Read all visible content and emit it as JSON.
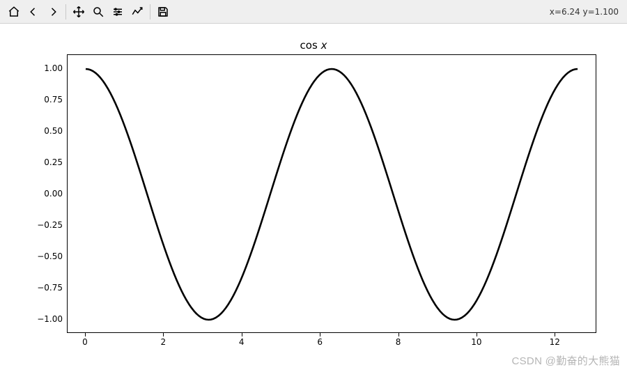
{
  "toolbar": {
    "icons": [
      {
        "name": "home-icon"
      },
      {
        "name": "back-icon"
      },
      {
        "name": "forward-icon"
      },
      {
        "_sep": true
      },
      {
        "name": "pan-icon"
      },
      {
        "name": "zoom-icon"
      },
      {
        "name": "subplots-icon"
      },
      {
        "name": "customize-icon"
      },
      {
        "_sep": true
      },
      {
        "name": "save-icon"
      }
    ],
    "coord_readout": "x=6.24 y=1.100"
  },
  "chart_data": {
    "type": "line",
    "title": "cos x",
    "xlabel": "",
    "ylabel": "",
    "xlim": [
      0,
      12.6
    ],
    "ylim": [
      -1.0,
      1.0
    ],
    "xticks": [
      0,
      2,
      4,
      6,
      8,
      10,
      12
    ],
    "yticks": [
      -1.0,
      -0.75,
      -0.5,
      -0.25,
      0.0,
      0.25,
      0.5,
      0.75,
      1.0
    ],
    "ytick_labels": [
      "−1.00",
      "−0.75",
      "−0.50",
      "−0.25",
      "0.00",
      "0.25",
      "0.50",
      "0.75",
      "1.00"
    ],
    "series": [
      {
        "name": "cos x",
        "function": "cos(x)",
        "x_range": [
          0,
          12.566
        ],
        "n_points": 200
      }
    ]
  },
  "watermark": "CSDN @勤奋的大熊猫"
}
